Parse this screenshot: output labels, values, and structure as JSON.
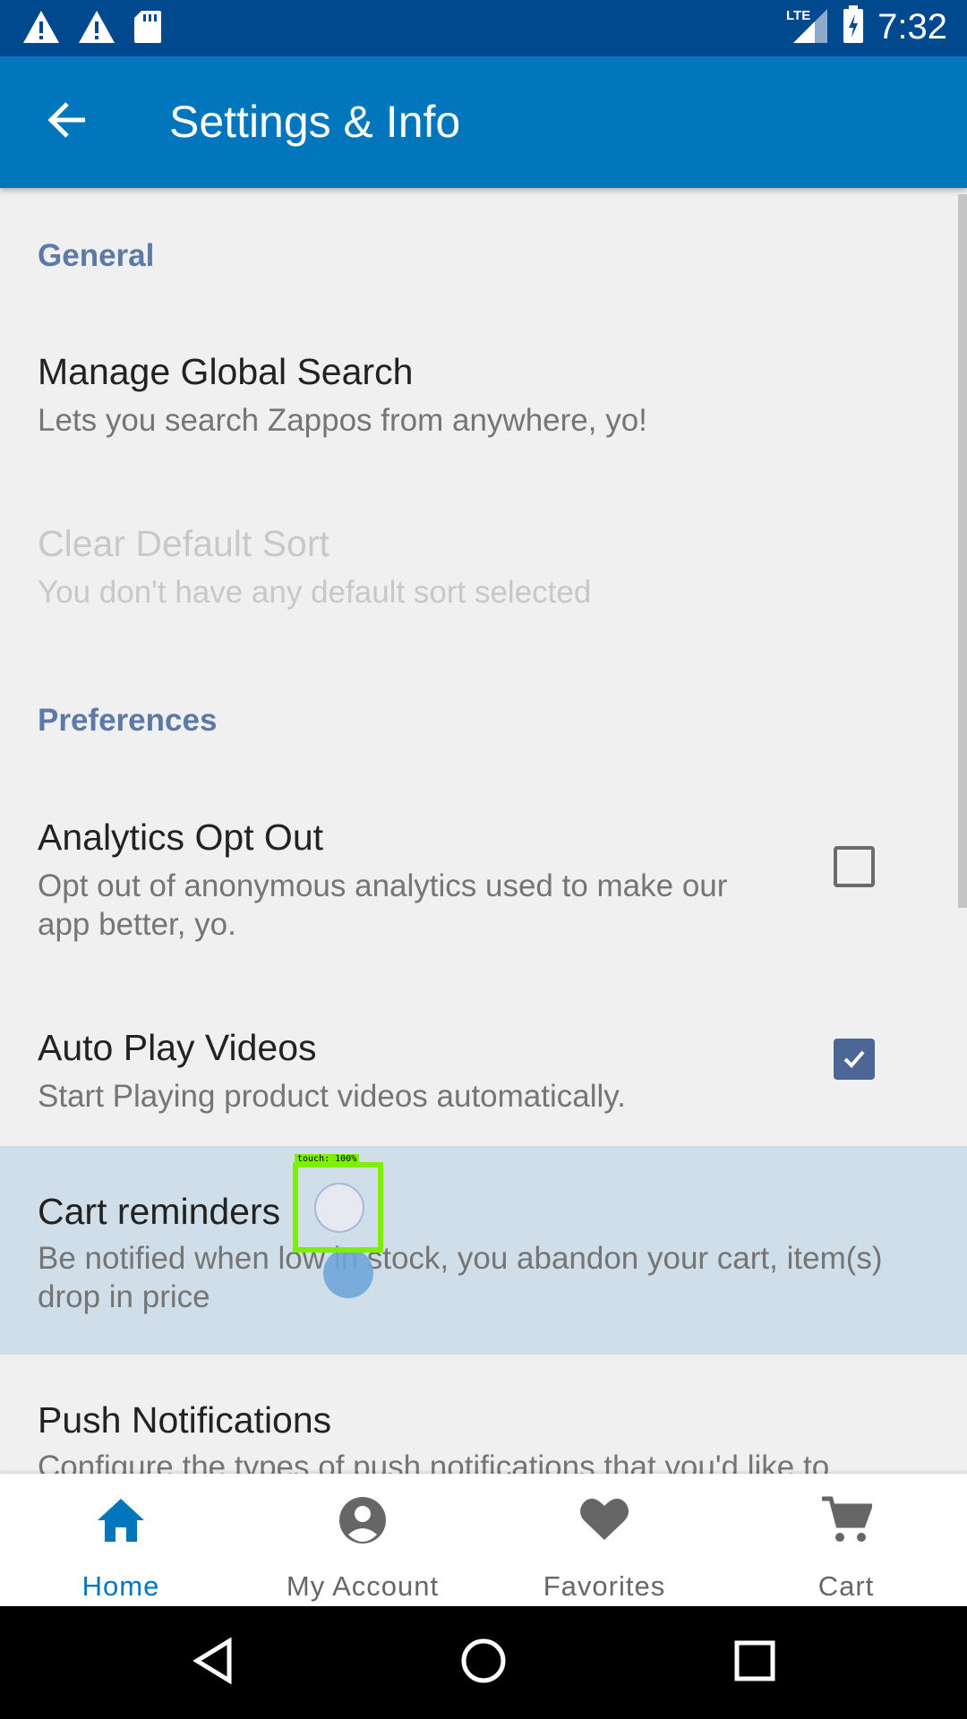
{
  "status_bar": {
    "time": "7:32",
    "network": "LTE",
    "icons_left": [
      "warning-icon",
      "warning-icon",
      "sd-card-icon"
    ],
    "icons_right": [
      "signal-icon",
      "battery-charging-icon"
    ]
  },
  "app_bar": {
    "title": "Settings & Info",
    "back_icon": "arrow-left-icon"
  },
  "sections": {
    "general": {
      "header": "General"
    },
    "preferences": {
      "header": "Preferences"
    }
  },
  "settings": {
    "manage_search": {
      "title": "Manage Global Search",
      "subtitle": "Lets you search Zappos from anywhere, yo!"
    },
    "clear_sort": {
      "title": "Clear Default Sort",
      "subtitle": "You don't have any default sort selected",
      "enabled": false
    },
    "analytics": {
      "title": "Analytics Opt Out",
      "subtitle": "Opt out of anonymous analytics used to make our app better, yo.",
      "checked": false
    },
    "auto_play": {
      "title": "Auto Play Videos",
      "subtitle": "Start Playing product videos automatically.",
      "checked": true
    },
    "cart_reminders": {
      "title": "Cart reminders",
      "subtitle": "Be notified when low in stock, you abandon your cart, item(s) drop in price"
    },
    "push_notifications": {
      "title": "Push Notifications",
      "subtitle": "Configure the types of push notifications that you'd like to"
    }
  },
  "touch_overlay": {
    "label": "touch: 100%"
  },
  "bottom_nav": [
    {
      "label": "Home",
      "icon": "home-icon",
      "active": true
    },
    {
      "label": "My Account",
      "icon": "account-icon",
      "active": false
    },
    {
      "label": "Favorites",
      "icon": "heart-icon",
      "active": false
    },
    {
      "label": "Cart",
      "icon": "cart-icon",
      "active": false
    }
  ],
  "colors": {
    "status_bar": "#01498e",
    "app_bar": "#0276bd",
    "accent": "#0276bd",
    "section_header": "#5b7aa8",
    "checkbox_checked": "#4c6698",
    "highlight_row": "#cfdee9"
  }
}
